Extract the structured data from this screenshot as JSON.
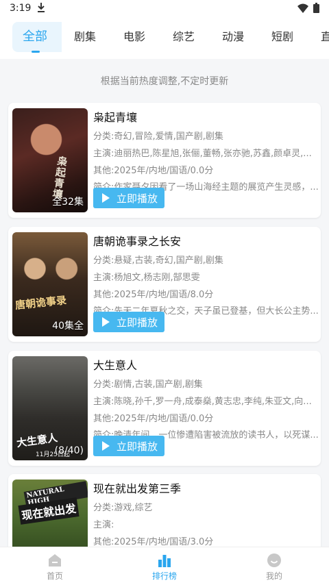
{
  "status_bar": {
    "time": "3:19",
    "icons": [
      "download-icon",
      "wifi-icon",
      "battery-icon"
    ]
  },
  "tabs": [
    {
      "label": "全部",
      "active": true
    },
    {
      "label": "剧集",
      "active": false
    },
    {
      "label": "电影",
      "active": false
    },
    {
      "label": "综艺",
      "active": false
    },
    {
      "label": "动漫",
      "active": false
    },
    {
      "label": "短剧",
      "active": false
    },
    {
      "label": "直",
      "active": false
    }
  ],
  "notice": "根据当前热度调整,不定时更新",
  "play_label": "立即播放",
  "items": [
    {
      "title": "枭起青壤",
      "category": "分类:奇幻,冒险,爱情,国产剧,剧集",
      "cast": "主演:迪丽热巴,陈星旭,张俪,董畅,张亦驰,苏鑫,颜卓灵,...",
      "other": "其他:2025年/内地/国语/0.0分",
      "intro": "简介:作家聂夕因看了一场山海经主题的展览产生灵感，...",
      "badge": "全32集",
      "poster_text": "枭起青壤"
    },
    {
      "title": "唐朝诡事录之长安",
      "category": "分类:悬疑,古装,奇幻,国产剧,剧集",
      "cast": "主演:杨旭文,杨志刚,郜思雯",
      "other": "其他:2025年/内地/国语/8.0分",
      "intro": "简介:先天二年夏秋之交，天子虽已登基，但大长公主势...",
      "badge": "40集全",
      "poster_text": "唐朝诡事录"
    },
    {
      "title": "大生意人",
      "category": "分类:剧情,古装,国产剧,剧集",
      "cast": "主演:陈晓,孙千,罗一舟,成泰燊,黄志忠,李纯,朱亚文,向...",
      "other": "其他:2025年/内地/国语/0.0分",
      "intro": "简介:晚清年间，一位惨遭陷害被流放的读书人，以死谋...",
      "badge": "(8/40)",
      "poster_text": "大生意人",
      "poster_date": "11月25日起"
    },
    {
      "title": "现在就出发第三季",
      "category": "分类:游戏,综艺",
      "cast": "主演:",
      "other": "其他:2025年/内地/国语/3.0分",
      "intro": "",
      "badge": "",
      "poster_text": "现在就出发",
      "poster_sub": "NATURAL HIGH"
    }
  ],
  "bottom_nav": [
    {
      "label": "首页",
      "icon": "home-icon",
      "active": false
    },
    {
      "label": "排行榜",
      "icon": "ranking-icon",
      "active": true
    },
    {
      "label": "我的",
      "icon": "profile-icon",
      "active": false
    }
  ],
  "colors": {
    "accent": "#2aa6ee",
    "play_button": "#47b8f0",
    "background": "#f5f6f8"
  }
}
